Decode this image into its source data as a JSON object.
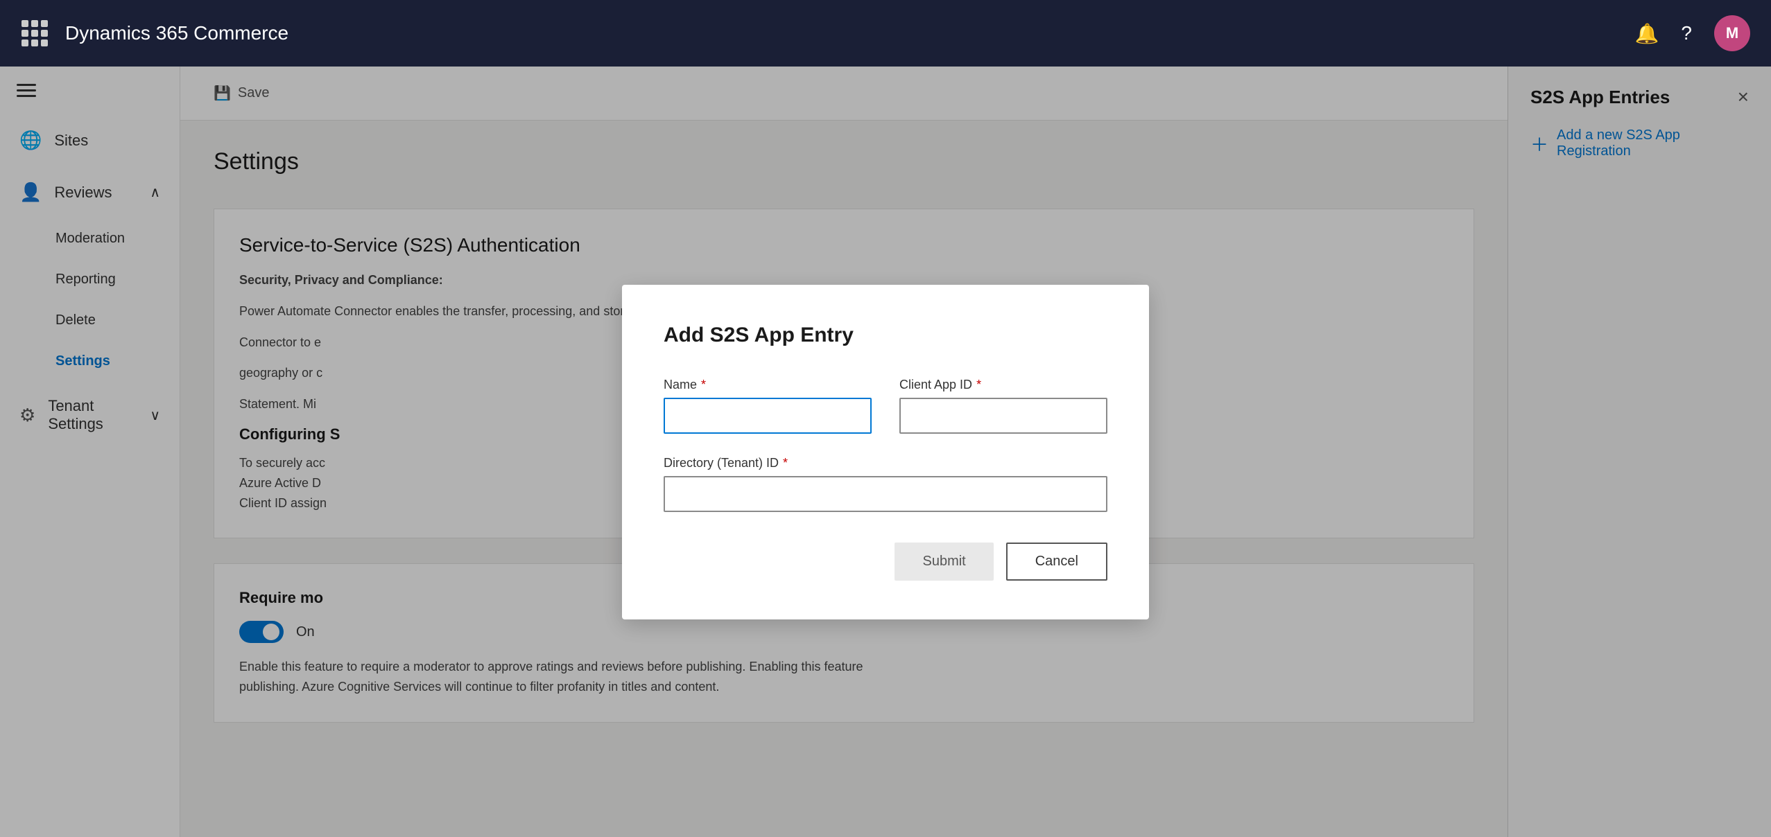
{
  "app": {
    "title": "Dynamics 365 Commerce",
    "avatar_initial": "M"
  },
  "sidebar": {
    "hamburger_label": "Menu",
    "items": [
      {
        "id": "sites",
        "label": "Sites",
        "icon": "🌐"
      },
      {
        "id": "reviews",
        "label": "Reviews",
        "icon": "👤",
        "expanded": true
      },
      {
        "id": "moderation",
        "label": "Moderation",
        "sub": true
      },
      {
        "id": "reporting",
        "label": "Reporting",
        "sub": true
      },
      {
        "id": "delete",
        "label": "Delete",
        "sub": true
      },
      {
        "id": "settings",
        "label": "Settings",
        "sub": true,
        "active": true
      },
      {
        "id": "tenant-settings",
        "label": "Tenant Settings",
        "icon": "⚙",
        "has_expand": true
      }
    ]
  },
  "toolbar": {
    "save_icon": "💾",
    "save_label": "Save"
  },
  "main": {
    "page_title": "Settings",
    "section_title": "Service-to-Service (S2S) Authentication",
    "section_label": "Security, Privacy and Compliance:",
    "section_desc": "Power Automate Connector enables the transfer, processing, and storage of your Ratings and Reviews data. Please",
    "section_desc2": "Connector to e",
    "section_desc3": "geography or c",
    "section_desc4": "Statement. Mi",
    "configure_label": "Configuring S",
    "configure_desc1": "To securely acc",
    "configure_desc2": "Azure Active D",
    "configure_desc3": "Client ID assign",
    "require_label": "Require mo",
    "toggle_state": "On",
    "require_desc": "Enable this feature to require a moderator to approve ratings and reviews before publishing. Enabling this feature",
    "require_desc2": "publishing. Azure Cognitive Services will continue to filter profanity in titles and content."
  },
  "right_panel": {
    "title": "S2S App Entries",
    "close_label": "×",
    "add_label": "Add a new S2S App Registration"
  },
  "modal": {
    "title": "Add S2S App Entry",
    "name_label": "Name",
    "name_required": "*",
    "client_app_id_label": "Client App ID",
    "client_app_id_required": "*",
    "directory_id_label": "Directory (Tenant) ID",
    "directory_id_required": "*",
    "submit_label": "Submit",
    "cancel_label": "Cancel"
  }
}
